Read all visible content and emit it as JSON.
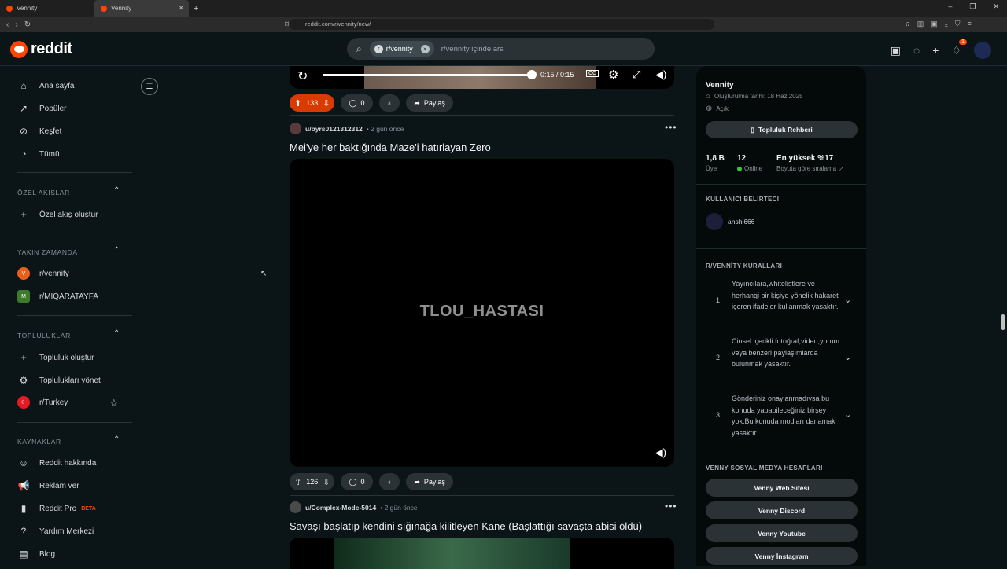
{
  "browser": {
    "tabs": [
      {
        "label": "Vennity"
      },
      {
        "label": "Vennity"
      }
    ],
    "new_tab": "+",
    "url": "reddit.com/r/vennity/new/"
  },
  "header": {
    "logo_text": "reddit",
    "search": {
      "chip_label": "r/vennity",
      "placeholder": "r/vennity içinde ara"
    },
    "notification_count": "1"
  },
  "sidebar": {
    "main": [
      {
        "label": "Ana sayfa",
        "icon": "home-icon"
      },
      {
        "label": "Popüler",
        "icon": "popular-icon"
      },
      {
        "label": "Keşfet",
        "icon": "explore-icon"
      },
      {
        "label": "Tümü",
        "icon": "all-icon"
      }
    ],
    "custom_feeds": {
      "title": "ÖZEL AKIŞLAR",
      "items": [
        {
          "label": "Özel akış oluştur"
        }
      ]
    },
    "recent": {
      "title": "YAKIN ZAMANDA",
      "items": [
        {
          "label": "r/vennity"
        },
        {
          "label": "r/MIQARATAYFA"
        }
      ]
    },
    "communities": {
      "title": "TOPLULUKLAR",
      "items": [
        {
          "label": "Topluluk oluştur"
        },
        {
          "label": "Toplulukları yönet"
        },
        {
          "label": "r/Turkey"
        }
      ]
    },
    "resources": {
      "title": "KAYNAKLAR",
      "items": [
        {
          "label": "Reddit hakkında"
        },
        {
          "label": "Reklam ver"
        },
        {
          "label": "Reddit Pro"
        },
        {
          "label": "Yardım Merkezi"
        },
        {
          "label": "Blog"
        }
      ],
      "beta": "BETA"
    }
  },
  "video_controls": {
    "time": "0:15 / 0:15",
    "cc": "CC"
  },
  "posts": [
    {
      "votes": "133",
      "comments": "0",
      "share": "Paylaş"
    },
    {
      "user": "u/byrs0121312312",
      "time": "2 gün önce",
      "title": "Mei'ye her baktığında Maze'i hatırlayan Zero",
      "watermark": "TLOU_HASTASI",
      "votes": "126",
      "comments": "0",
      "share": "Paylaş"
    },
    {
      "user": "u/Complex-Mode-5014",
      "time": "2 gün önce",
      "title": "Savaşı başlatıp kendini sığınağa kilitleyen Kane (Başlattığı savaşta abisi öldü)"
    }
  ],
  "community": {
    "name": "Vennity",
    "created": "Oluşturulma tarihi: 18 Haz 2025",
    "visibility": "Açık",
    "guide_button": "Topluluk Rehberi",
    "members_value": "1,8 B",
    "members_label": "Üye",
    "online_value": "12",
    "online_label": "Online",
    "rank_value": "En yüksek %17",
    "rank_label": "Boyuta göre sıralama",
    "flair_title": "KULLANICI BELİRTECİ",
    "flair_user": "anshi666",
    "rules_title": "R/VENNİTY KURALLARI",
    "rules": [
      {
        "num": "1",
        "text": "Yayıncılara,whitelistlere ve herhangi bir kişiye yönelik hakaret içeren ifadeler kullanmak yasaktır."
      },
      {
        "num": "2",
        "text": "Cinsel içerikli fotoğraf,video,yorum veya benzeri paylaşımlarda bulunmak yasaktır."
      },
      {
        "num": "3",
        "text": "Gönderiniz onaylanmadıysa bu konuda yapabileceğiniz birşey yok.Bu konuda modları darlamak yasaktır."
      }
    ],
    "social_title": "VENNY SOSYAL MEDYA HESAPLARI",
    "social": [
      {
        "label": "Venny Web Sitesi"
      },
      {
        "label": "Venny Discord"
      },
      {
        "label": "Venny Youtube"
      },
      {
        "label": "Venny İnstagram"
      }
    ]
  }
}
